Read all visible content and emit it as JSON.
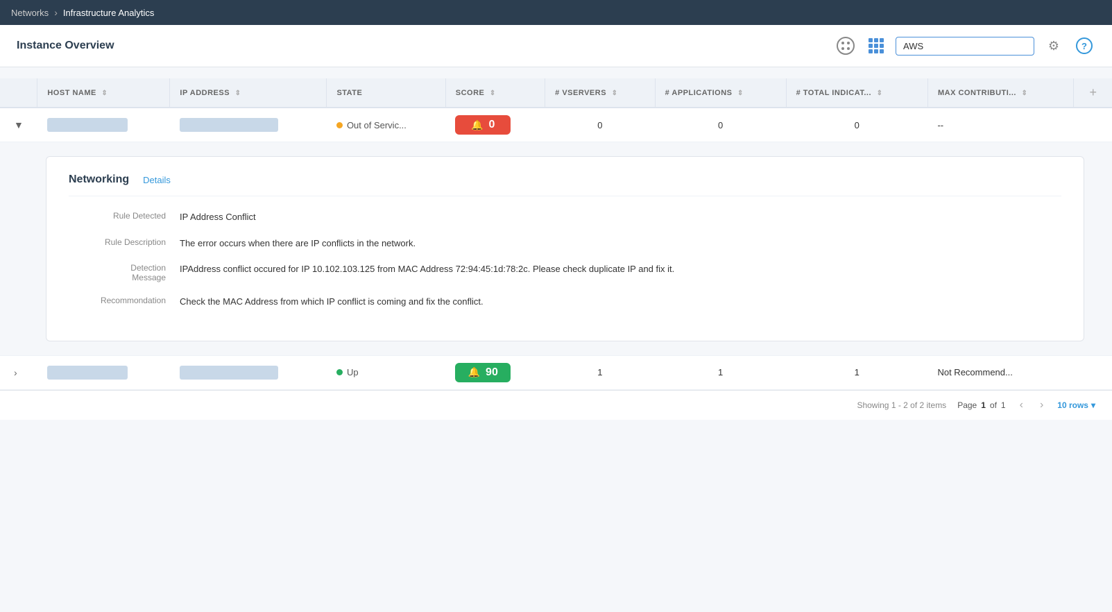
{
  "nav": {
    "parent": "Networks",
    "separator": "›",
    "current": "Infrastructure Analytics"
  },
  "page": {
    "title": "Instance Overview",
    "search_value": "AWS"
  },
  "icons": {
    "dots": "dots-icon",
    "table": "table-icon",
    "settings": "⚙",
    "help": "?",
    "add_col": "+"
  },
  "table": {
    "columns": [
      {
        "id": "expand",
        "label": ""
      },
      {
        "id": "hostname",
        "label": "HOST NAME"
      },
      {
        "id": "ipaddress",
        "label": "IP ADDRESS"
      },
      {
        "id": "state",
        "label": "STATE"
      },
      {
        "id": "score",
        "label": "SCORE"
      },
      {
        "id": "vservers",
        "label": "# VSERVERS"
      },
      {
        "id": "applications",
        "label": "# APPLICATIONS"
      },
      {
        "id": "indicators",
        "label": "# TOTAL INDICAT..."
      },
      {
        "id": "contribution",
        "label": "MAX CONTRIBUTI..."
      }
    ],
    "rows": [
      {
        "id": "row1",
        "expanded": true,
        "expand_icon": "▼",
        "hostname": "████ ██████",
        "ipaddress": "███████ ███ ██",
        "state": "Out of Servic...",
        "state_type": "out",
        "score": "0",
        "score_type": "red",
        "vservers": "0",
        "applications": "0",
        "indicators": "0",
        "contribution": "--",
        "detail": {
          "section_title": "Networking",
          "detail_link": "Details",
          "fields": [
            {
              "label": "Rule Detected",
              "value": "IP Address Conflict"
            },
            {
              "label": "Rule Description",
              "value": "The error occurs when there are IP conflicts in the network."
            },
            {
              "label": "Detection Message",
              "value": "IPAddress conflict occured for IP 10.102.103.125 from MAC Address 72:94:45:1d:78:2c. Please check duplicate IP and fix it."
            },
            {
              "label": "Recommondation",
              "value": "Check the MAC Address from which IP conflict is coming and fix the conflict."
            }
          ]
        }
      },
      {
        "id": "row2",
        "expanded": false,
        "expand_icon": "›",
        "hostname": "████ ██████",
        "ipaddress": "███████ ███ ██",
        "state": "Up",
        "state_type": "up",
        "score": "90",
        "score_type": "green",
        "vservers": "1",
        "applications": "1",
        "indicators": "1",
        "contribution": "Not Recommend..."
      }
    ]
  },
  "pagination": {
    "showing": "Showing 1 - 2 of 2 items",
    "page_label": "Page",
    "page_current": "1",
    "page_of": "of",
    "page_total": "1",
    "rows_label": "10 rows"
  }
}
